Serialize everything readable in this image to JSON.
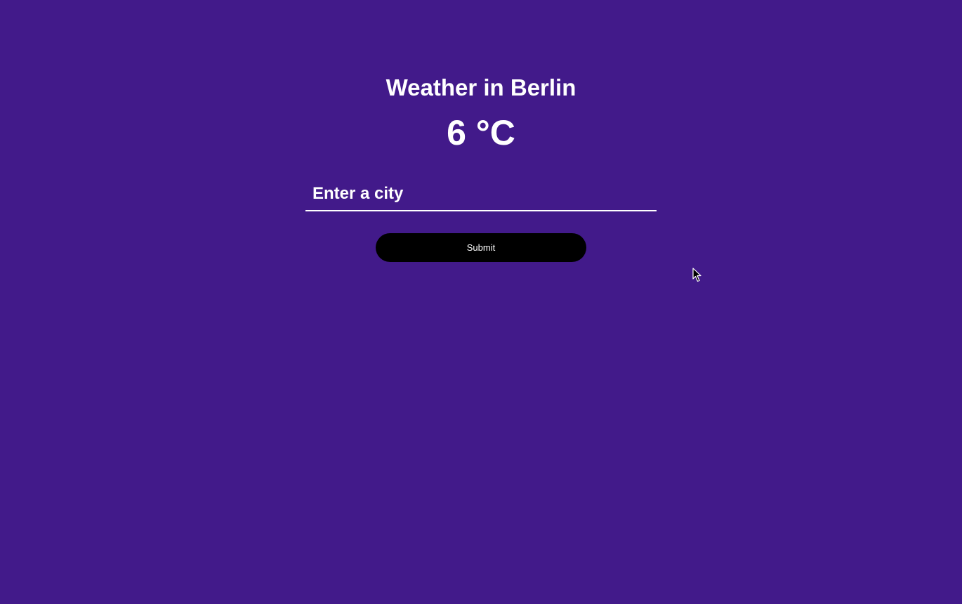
{
  "header": {
    "title": "Weather in Berlin",
    "temperature": "6 °C"
  },
  "search": {
    "placeholder": "Enter a city",
    "value": ""
  },
  "form": {
    "submit_label": "Submit"
  },
  "colors": {
    "background": "#421a8a",
    "text": "#ffffff",
    "button": "#000000"
  },
  "icons": {
    "cursor": "mouse-pointer-icon"
  }
}
